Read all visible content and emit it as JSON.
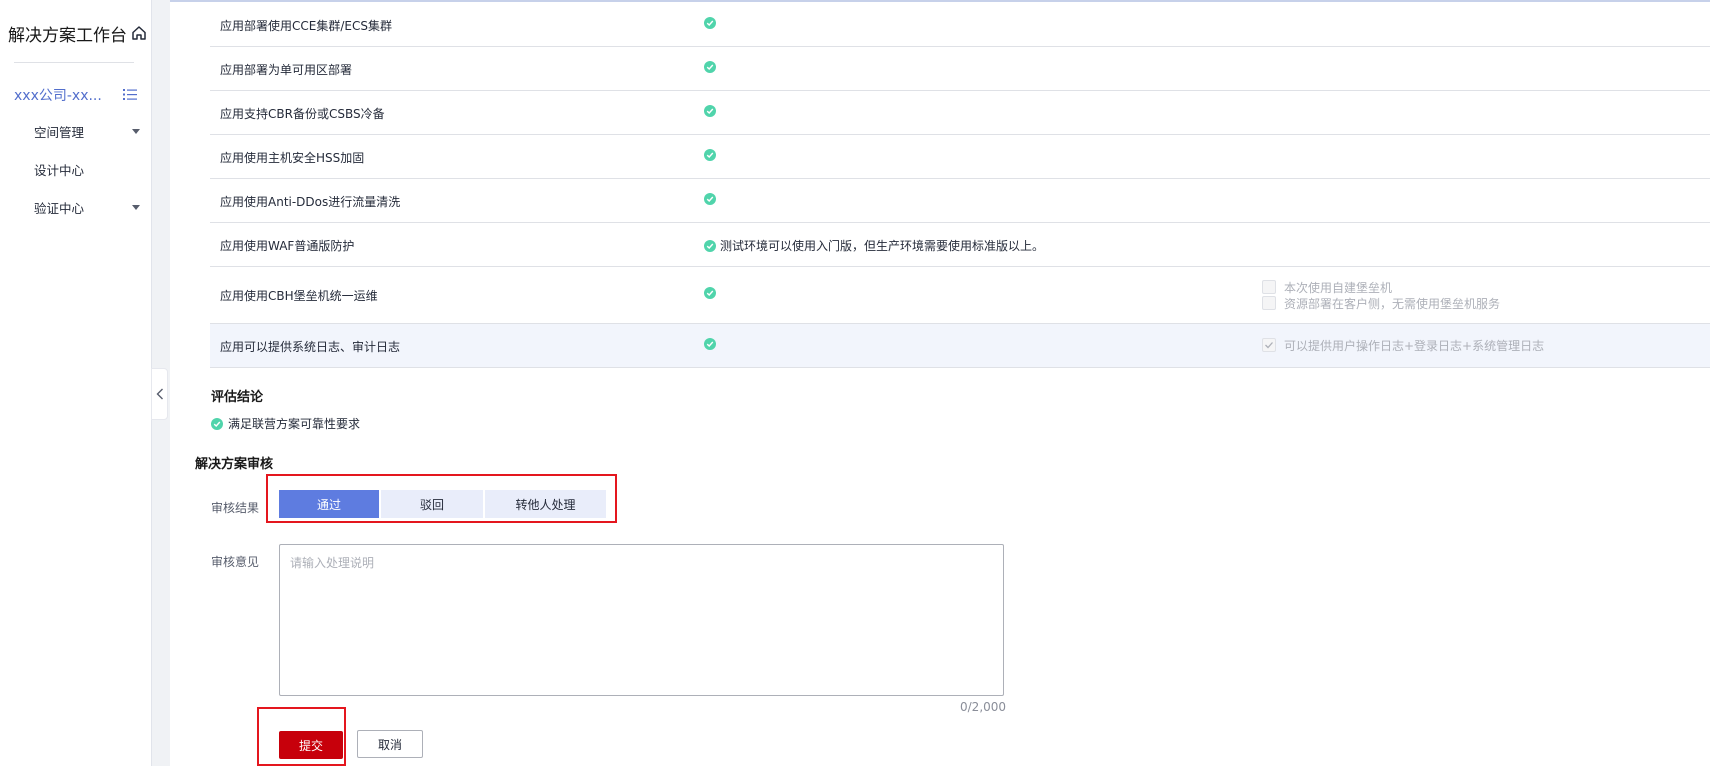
{
  "sidebar": {
    "title": "解决方案工作台",
    "workspace": "xxx公司-xx...",
    "items": [
      {
        "label": "空间管理"
      },
      {
        "label": "设计中心"
      },
      {
        "label": "验证中心"
      }
    ]
  },
  "checklist": [
    {
      "name": "应用部署使用CCE集群/ECS集群",
      "status": "passed",
      "note": ""
    },
    {
      "name": "应用部署为单可用区部署",
      "status": "passed",
      "note": ""
    },
    {
      "name": "应用支持CBR备份或CSBS冷备",
      "status": "passed",
      "note": ""
    },
    {
      "name": "应用使用主机安全HSS加固",
      "status": "passed",
      "note": ""
    },
    {
      "name": "应用使用Anti-DDos进行流量清洗",
      "status": "passed",
      "note": ""
    },
    {
      "name": "应用使用WAF普通版防护",
      "status": "passed",
      "note": "测试环境可以使用入门版，但生产环境需要使用标准版以上。"
    },
    {
      "name": "应用使用CBH堡垒机统一运维",
      "status": "passed",
      "note": "",
      "options": [
        {
          "label": "本次使用自建堡垒机",
          "checked": false
        },
        {
          "label": "资源部署在客户侧，无需使用堡垒机服务",
          "checked": false
        }
      ]
    },
    {
      "name": "应用可以提供系统日志、审计日志",
      "status": "passed",
      "note": "",
      "options": [
        {
          "label": "可以提供用户操作日志+登录日志+系统管理日志",
          "checked": true
        }
      ]
    }
  ],
  "evaluation": {
    "title": "评估结论",
    "result": "满足联营方案可靠性要求"
  },
  "review": {
    "title": "解决方案审核",
    "result_label": "审核结果",
    "options": [
      "通过",
      "驳回",
      "转他人处理"
    ],
    "selected": "通过",
    "opinion_label": "审核意见",
    "placeholder": "请输入处理说明",
    "counter": "0/2,000",
    "submit": "提交",
    "cancel": "取消"
  },
  "colors": {
    "accent": "#5e7ce0",
    "success": "#50d4ab",
    "danger": "#c7000b",
    "annotation": "#e4161e"
  }
}
